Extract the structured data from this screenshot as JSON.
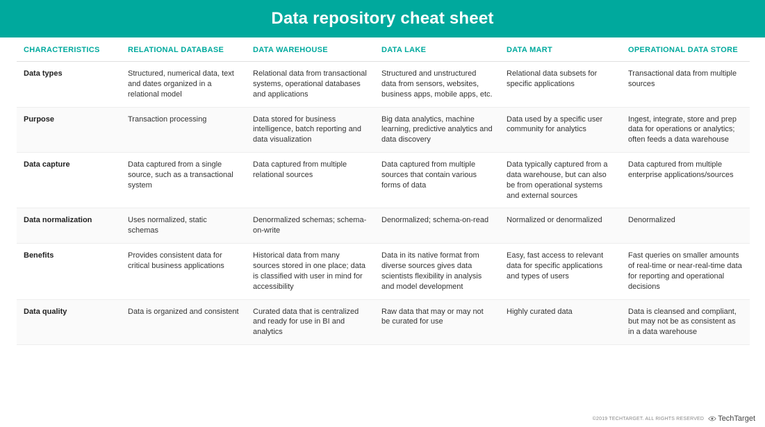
{
  "title": "Data repository cheat sheet",
  "columns": [
    "CHARACTERISTICS",
    "RELATIONAL DATABASE",
    "DATA WAREHOUSE",
    "DATA LAKE",
    "DATA MART",
    "OPERATIONAL DATA STORE"
  ],
  "rows": [
    {
      "label": "Data types",
      "cells": [
        "Structured, numerical data, text and dates organized in a relational model",
        "Relational data from transactional systems, operational databases and applications",
        "Structured and unstructured data from sensors, websites, business apps, mobile apps, etc.",
        "Relational data subsets for specific applications",
        "Transactional data from multiple sources"
      ]
    },
    {
      "label": "Purpose",
      "cells": [
        "Transaction processing",
        "Data stored for business intelligence, batch reporting and data visualization",
        "Big data analytics, machine learning, predictive analytics and data discovery",
        "Data used by a specific user community for analytics",
        "Ingest, integrate, store and prep data for operations or analytics; often feeds a data warehouse"
      ]
    },
    {
      "label": "Data capture",
      "cells": [
        "Data captured from a single source, such as a transactional system",
        "Data captured from multiple relational sources",
        "Data captured from multiple sources that contain various forms of data",
        "Data typically captured from a data warehouse, but can also be from operational systems and external sources",
        "Data captured from multiple enterprise applications/sources"
      ]
    },
    {
      "label": "Data normalization",
      "cells": [
        "Uses normalized, static schemas",
        "Denormalized schemas; schema-on-write",
        "Denormalized; schema-on-read",
        "Normalized or denormalized",
        "Denormalized"
      ]
    },
    {
      "label": "Benefits",
      "cells": [
        "Provides consistent data for critical business applications",
        "Historical data from many sources stored in one place; data is classified with user in mind for accessibility",
        "Data in its native format from diverse sources gives data scientists flexibility in analysis and model development",
        "Easy, fast access to relevant data for specific applications and types of users",
        "Fast queries on smaller amounts of real-time or near-real-time data for reporting and operational decisions"
      ]
    },
    {
      "label": "Data quality",
      "cells": [
        "Data is organized and consistent",
        "Curated data that is centralized and ready for use in BI and analytics",
        "Raw data that may or may not be curated for use",
        "Highly curated data",
        "Data is cleansed and compliant, but may not be as consistent as in a data warehouse"
      ]
    }
  ],
  "footer": {
    "copyright": "©2019 TECHTARGET. ALL RIGHTS RESERVED",
    "brand": "TechTarget"
  },
  "chart_data": {
    "type": "table",
    "title": "Data repository cheat sheet",
    "columns": [
      "CHARACTERISTICS",
      "RELATIONAL DATABASE",
      "DATA WAREHOUSE",
      "DATA LAKE",
      "DATA MART",
      "OPERATIONAL DATA STORE"
    ],
    "rows": [
      [
        "Data types",
        "Structured, numerical data, text and dates organized in a relational model",
        "Relational data from transactional systems, operational databases and applications",
        "Structured and unstructured data from sensors, websites, business apps, mobile apps, etc.",
        "Relational data subsets for specific applications",
        "Transactional data from multiple sources"
      ],
      [
        "Purpose",
        "Transaction processing",
        "Data stored for business intelligence, batch reporting and data visualization",
        "Big data analytics, machine learning, predictive analytics and data discovery",
        "Data used by a specific user community for analytics",
        "Ingest, integrate, store and prep data for operations or analytics; often feeds a data warehouse"
      ],
      [
        "Data capture",
        "Data captured from a single source, such as a transactional system",
        "Data captured from multiple relational sources",
        "Data captured from multiple sources that contain various forms of data",
        "Data typically captured from a data warehouse, but can also be from operational systems and external sources",
        "Data captured from multiple enterprise applications/sources"
      ],
      [
        "Data normalization",
        "Uses normalized, static schemas",
        "Denormalized schemas; schema-on-write",
        "Denormalized; schema-on-read",
        "Normalized or denormalized",
        "Denormalized"
      ],
      [
        "Benefits",
        "Provides consistent data for critical business applications",
        "Historical data from many sources stored in one place; data is classified with user in mind for accessibility",
        "Data in its native format from diverse sources gives data scientists flexibility in analysis and model development",
        "Easy, fast access to relevant data for specific applications and types of users",
        "Fast queries on smaller amounts of real-time or near-real-time data for reporting and operational decisions"
      ],
      [
        "Data quality",
        "Data is organized and consistent",
        "Curated data that is centralized and ready for use in BI and analytics",
        "Raw data that may or may not be curated for use",
        "Highly curated data",
        "Data is cleansed and compliant, but may not be as consistent as in a data warehouse"
      ]
    ]
  }
}
